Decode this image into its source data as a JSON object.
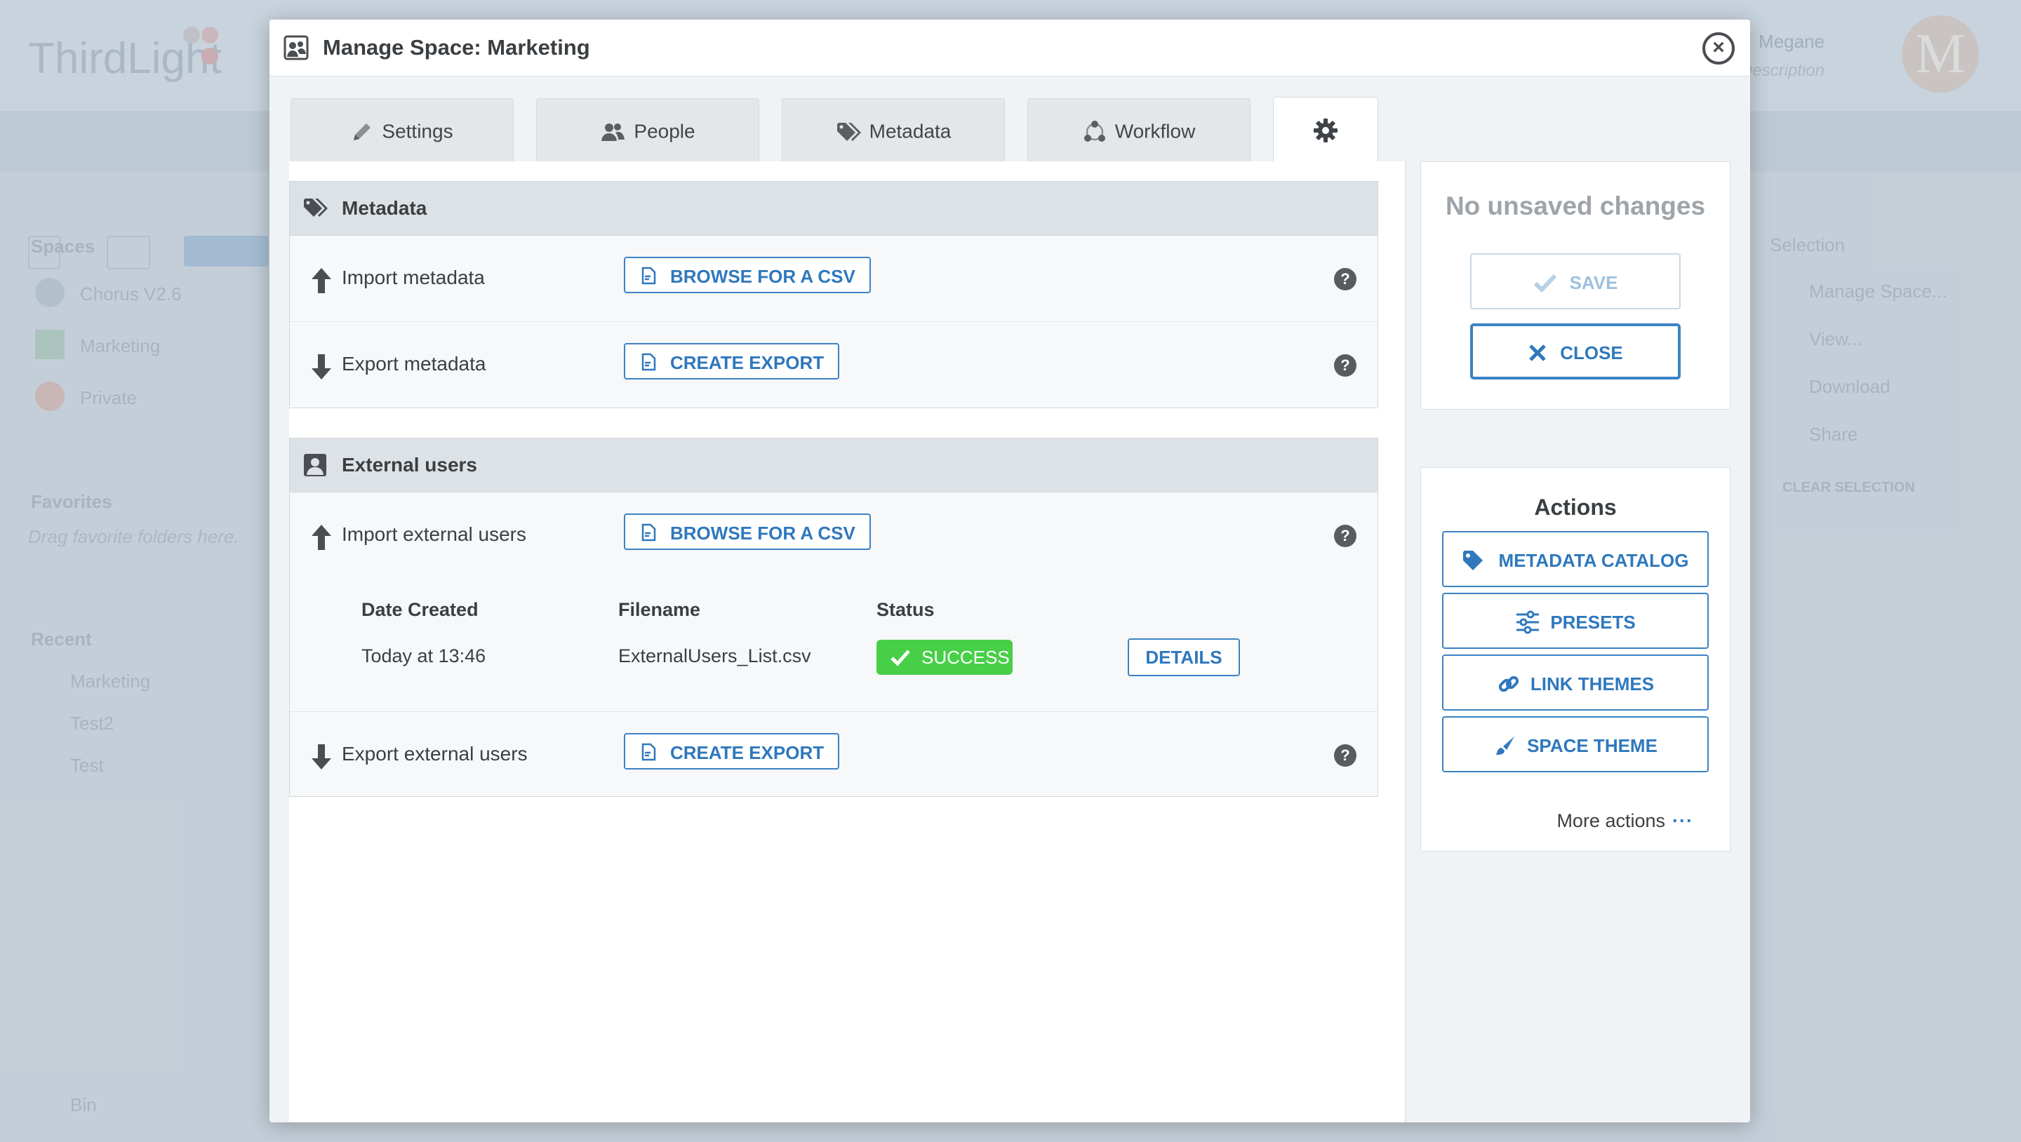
{
  "background": {
    "logo": "ThirdLight",
    "user_name": "Megane",
    "user_sub": "No Description",
    "avatar_initial": "M",
    "sidebar": {
      "spaces_heading": "Spaces",
      "spaces": [
        "Chorus V2.6",
        "Marketing",
        "Private"
      ],
      "favorites_heading": "Favorites",
      "favorites_hint": "Drag favorite folders here.",
      "recent_heading": "Recent",
      "recent": [
        "Marketing",
        "Test2",
        "Test"
      ],
      "bin": "Bin"
    },
    "right_panel": {
      "selection": "Selection",
      "items": [
        "Manage Space...",
        "View...",
        "Download",
        "Share"
      ],
      "clear": "CLEAR SELECTION"
    }
  },
  "modal": {
    "title": "Manage Space: Marketing",
    "tabs": [
      {
        "label": "Settings"
      },
      {
        "label": "People"
      },
      {
        "label": "Metadata"
      },
      {
        "label": "Workflow"
      }
    ],
    "metadata_panel": {
      "title": "Metadata",
      "import_label": "Import metadata",
      "import_button": "BROWSE FOR A CSV",
      "export_label": "Export metadata",
      "export_button": "CREATE EXPORT"
    },
    "external_panel": {
      "title": "External users",
      "import_label": "Import external users",
      "import_button": "BROWSE FOR A CSV",
      "table": {
        "headers": [
          "Date Created",
          "Filename",
          "Status"
        ],
        "row": {
          "date": "Today at 13:46",
          "filename": "ExternalUsers_List.csv",
          "status": "SUCCESS",
          "details_button": "DETAILS"
        }
      },
      "export_label": "Export external users",
      "export_button": "CREATE EXPORT"
    },
    "save_panel": {
      "status": "No unsaved changes",
      "save_button": "SAVE",
      "close_button": "CLOSE"
    },
    "actions_panel": {
      "title": "Actions",
      "buttons": [
        "METADATA CATALOG",
        "PRESETS",
        "LINK THEMES",
        "SPACE THEME"
      ],
      "more": "More actions"
    }
  },
  "colors": {
    "accent": "#2f78bd",
    "success": "#47cf47",
    "panel_header": "#dde2e6"
  }
}
